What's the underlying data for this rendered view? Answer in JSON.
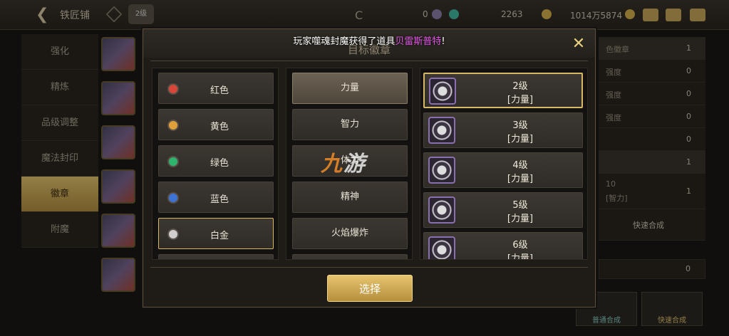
{
  "topbar": {
    "title": "铁匠铺",
    "badge": "2级",
    "currency_1": "0",
    "currency_2": "2263",
    "currency_3": "1014万5874"
  },
  "left_nav": [
    {
      "label": "强化",
      "active": false
    },
    {
      "label": "精炼",
      "active": false
    },
    {
      "label": "品级调整",
      "active": false
    },
    {
      "label": "魔法封印",
      "active": false
    },
    {
      "label": "徽章",
      "active": true
    },
    {
      "label": "附魔",
      "active": false
    }
  ],
  "right_bg": {
    "rows": [
      {
        "label": "色徽章",
        "value": "1"
      },
      {
        "label": "强度",
        "value": "0"
      },
      {
        "label": "强度",
        "value": "0"
      },
      {
        "label": "强度",
        "value": "0"
      },
      {
        "label": "",
        "value": "0"
      },
      {
        "label": "",
        "value": "1"
      }
    ],
    "power_info": "[智力]",
    "level_num": "10",
    "count": "1",
    "fast_combine": "快速合成",
    "normal_btn": "普通合成",
    "fast_btn": "快速合成",
    "bottom_value": "0"
  },
  "dialog": {
    "title": "目标徽章",
    "notice_prefix": "玩家噬魂封魔获得了道具",
    "notice_item": "贝雷斯普特",
    "notice_suffix": "!",
    "colors": [
      {
        "label": "红色",
        "color": "#d9473a",
        "selected": false
      },
      {
        "label": "黄色",
        "color": "#e0a03a",
        "selected": false
      },
      {
        "label": "绿色",
        "color": "#2fb46c",
        "selected": false
      },
      {
        "label": "蓝色",
        "color": "#3b74d6",
        "selected": false
      },
      {
        "label": "白金",
        "color": "#cfcfcf",
        "selected": true
      }
    ],
    "stats": [
      {
        "label": "力量",
        "selected": true
      },
      {
        "label": "智力",
        "selected": false
      },
      {
        "label": "体力",
        "selected": false
      },
      {
        "label": "精神",
        "selected": false
      },
      {
        "label": "火焰爆炸",
        "selected": false
      }
    ],
    "badges": [
      {
        "level": "2级",
        "attr": "[力量]",
        "selected": true
      },
      {
        "level": "3级",
        "attr": "[力量]",
        "selected": false
      },
      {
        "level": "4级",
        "attr": "[力量]",
        "selected": false
      },
      {
        "level": "5级",
        "attr": "[力量]",
        "selected": false
      },
      {
        "level": "6级",
        "attr": "[力量]",
        "selected": false
      }
    ],
    "choose_label": "选择"
  },
  "watermark": {
    "part1": "九",
    "part2": "游"
  }
}
